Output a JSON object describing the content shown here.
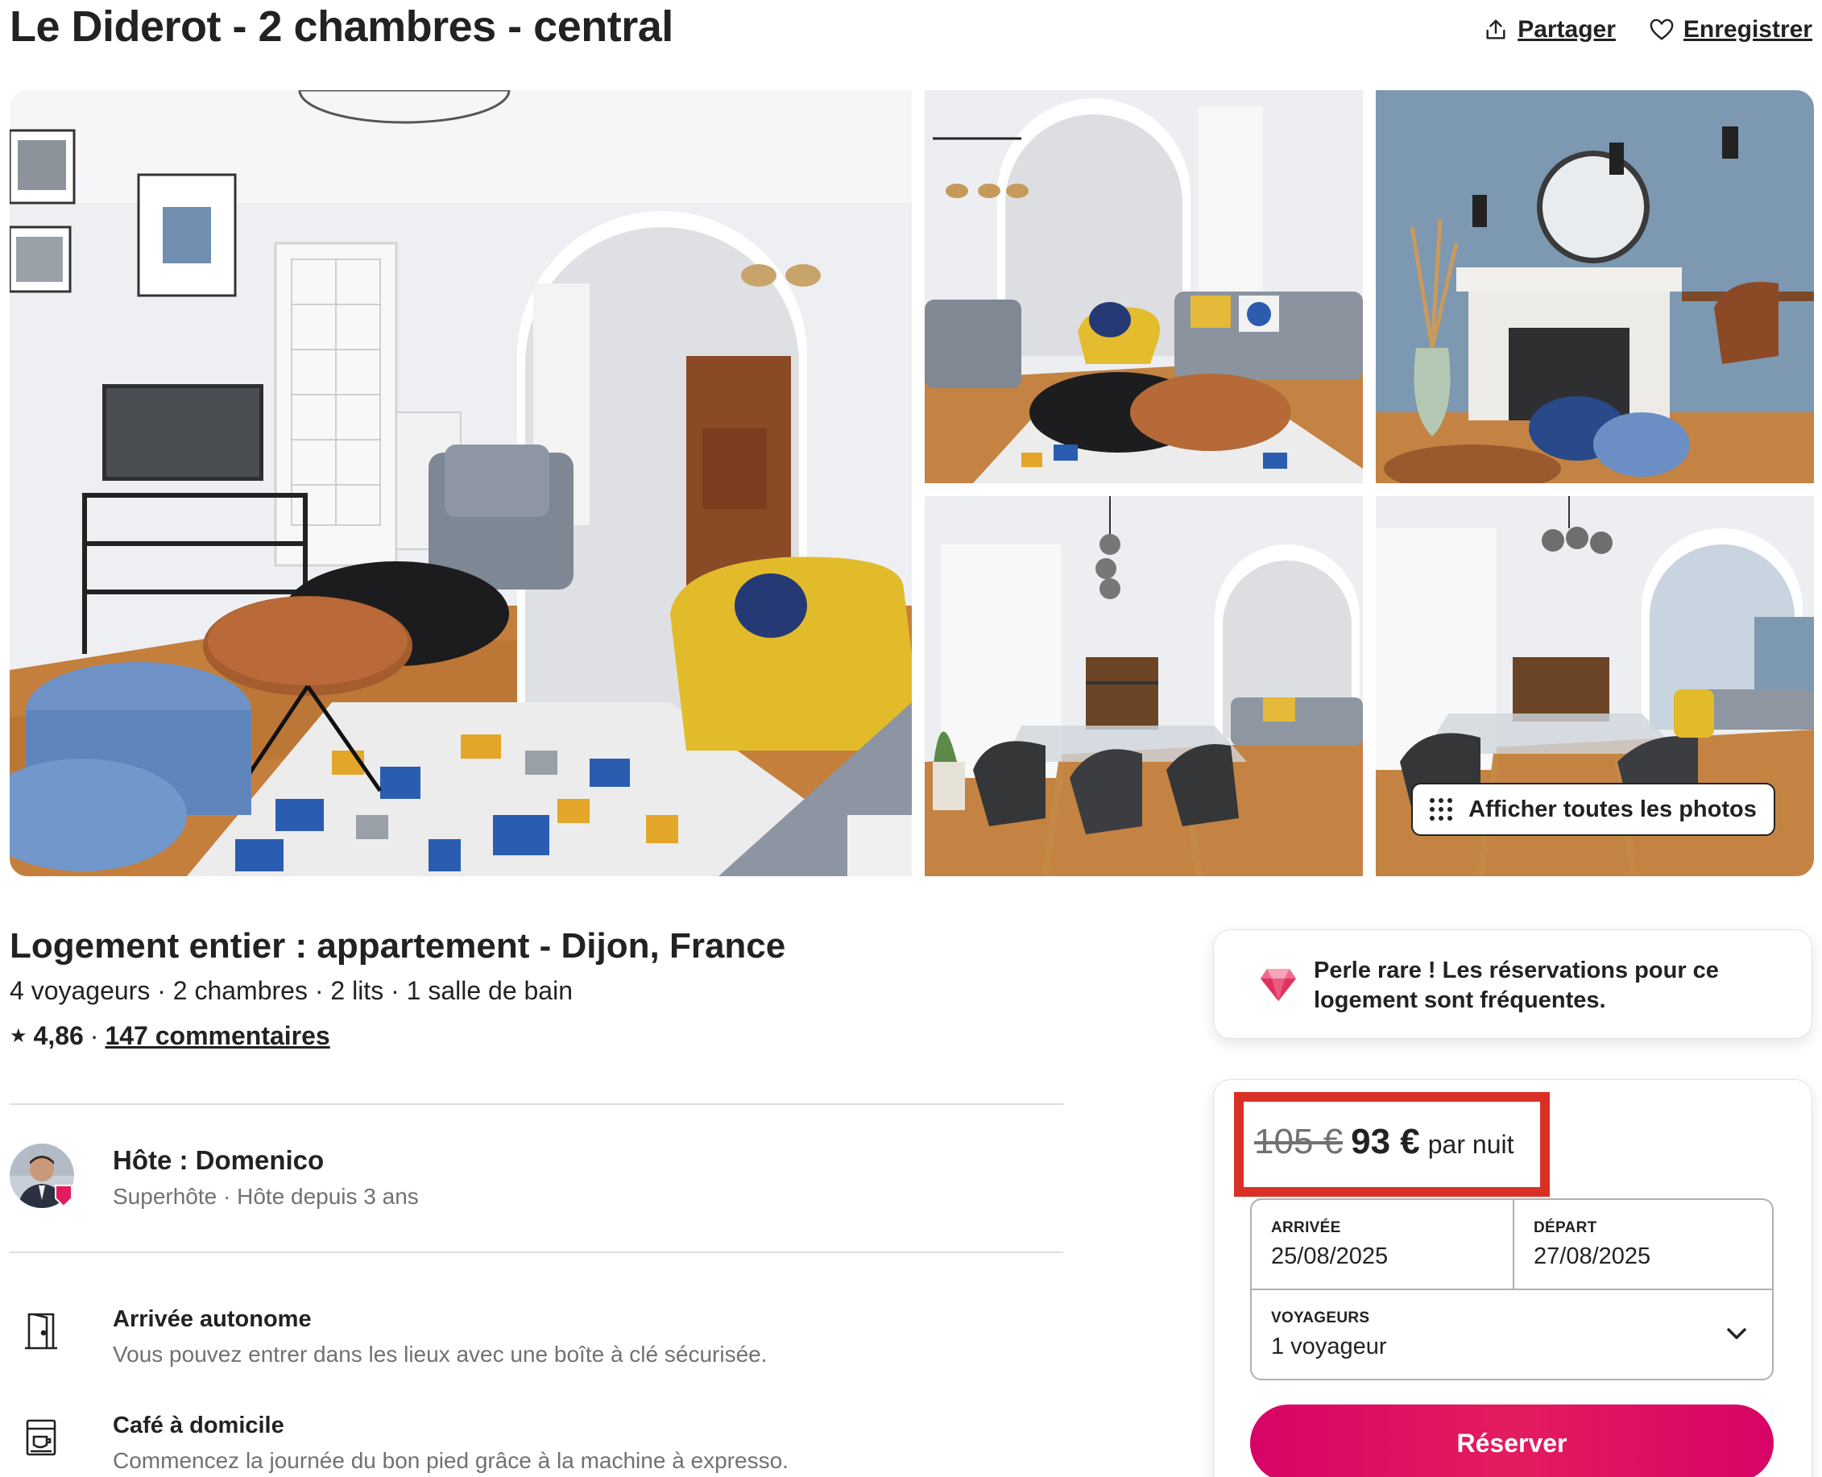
{
  "header": {
    "title": "Le Diderot - 2 chambres - central",
    "share_label": "Partager",
    "save_label": "Enregistrer"
  },
  "gallery": {
    "show_all_label": "Afficher toutes les photos"
  },
  "listing": {
    "type_location": "Logement entier : appartement - Dijon, France",
    "details": "4 voyageurs · 2 chambres · 2 lits · 1 salle de bain",
    "rating": "4,86",
    "separator": "·",
    "reviews_label": "147 commentaires"
  },
  "host": {
    "name_label": "Hôte : Domenico",
    "subtitle": "Superhôte · Hôte depuis 3 ans"
  },
  "features": [
    {
      "title": "Arrivée autonome",
      "description": "Vous pouvez entrer dans les lieux avec une boîte à clé sécurisée.",
      "icon": "door-icon"
    },
    {
      "title": "Café à domicile",
      "description": "Commencez la journée du bon pied grâce à la machine à expresso.",
      "icon": "coffee-machine-icon"
    }
  ],
  "rare_find": {
    "text": "Perle rare ! Les réservations pour ce logement sont fréquentes.",
    "icon": "gem-icon"
  },
  "booking": {
    "price_old": "105 €",
    "price_new": "93 €",
    "price_unit": "par nuit",
    "checkin_label": "ARRIVÉE",
    "checkin_value": "25/08/2025",
    "checkout_label": "DÉPART",
    "checkout_value": "27/08/2025",
    "guests_label": "VOYAGEURS",
    "guests_value": "1 voyageur",
    "reserve_label": "Réserver"
  },
  "colors": {
    "brand": "#e31c5f",
    "highlight_box": "#d93025",
    "text_primary": "#222222",
    "text_secondary": "#717171",
    "divider": "#dddddd"
  }
}
